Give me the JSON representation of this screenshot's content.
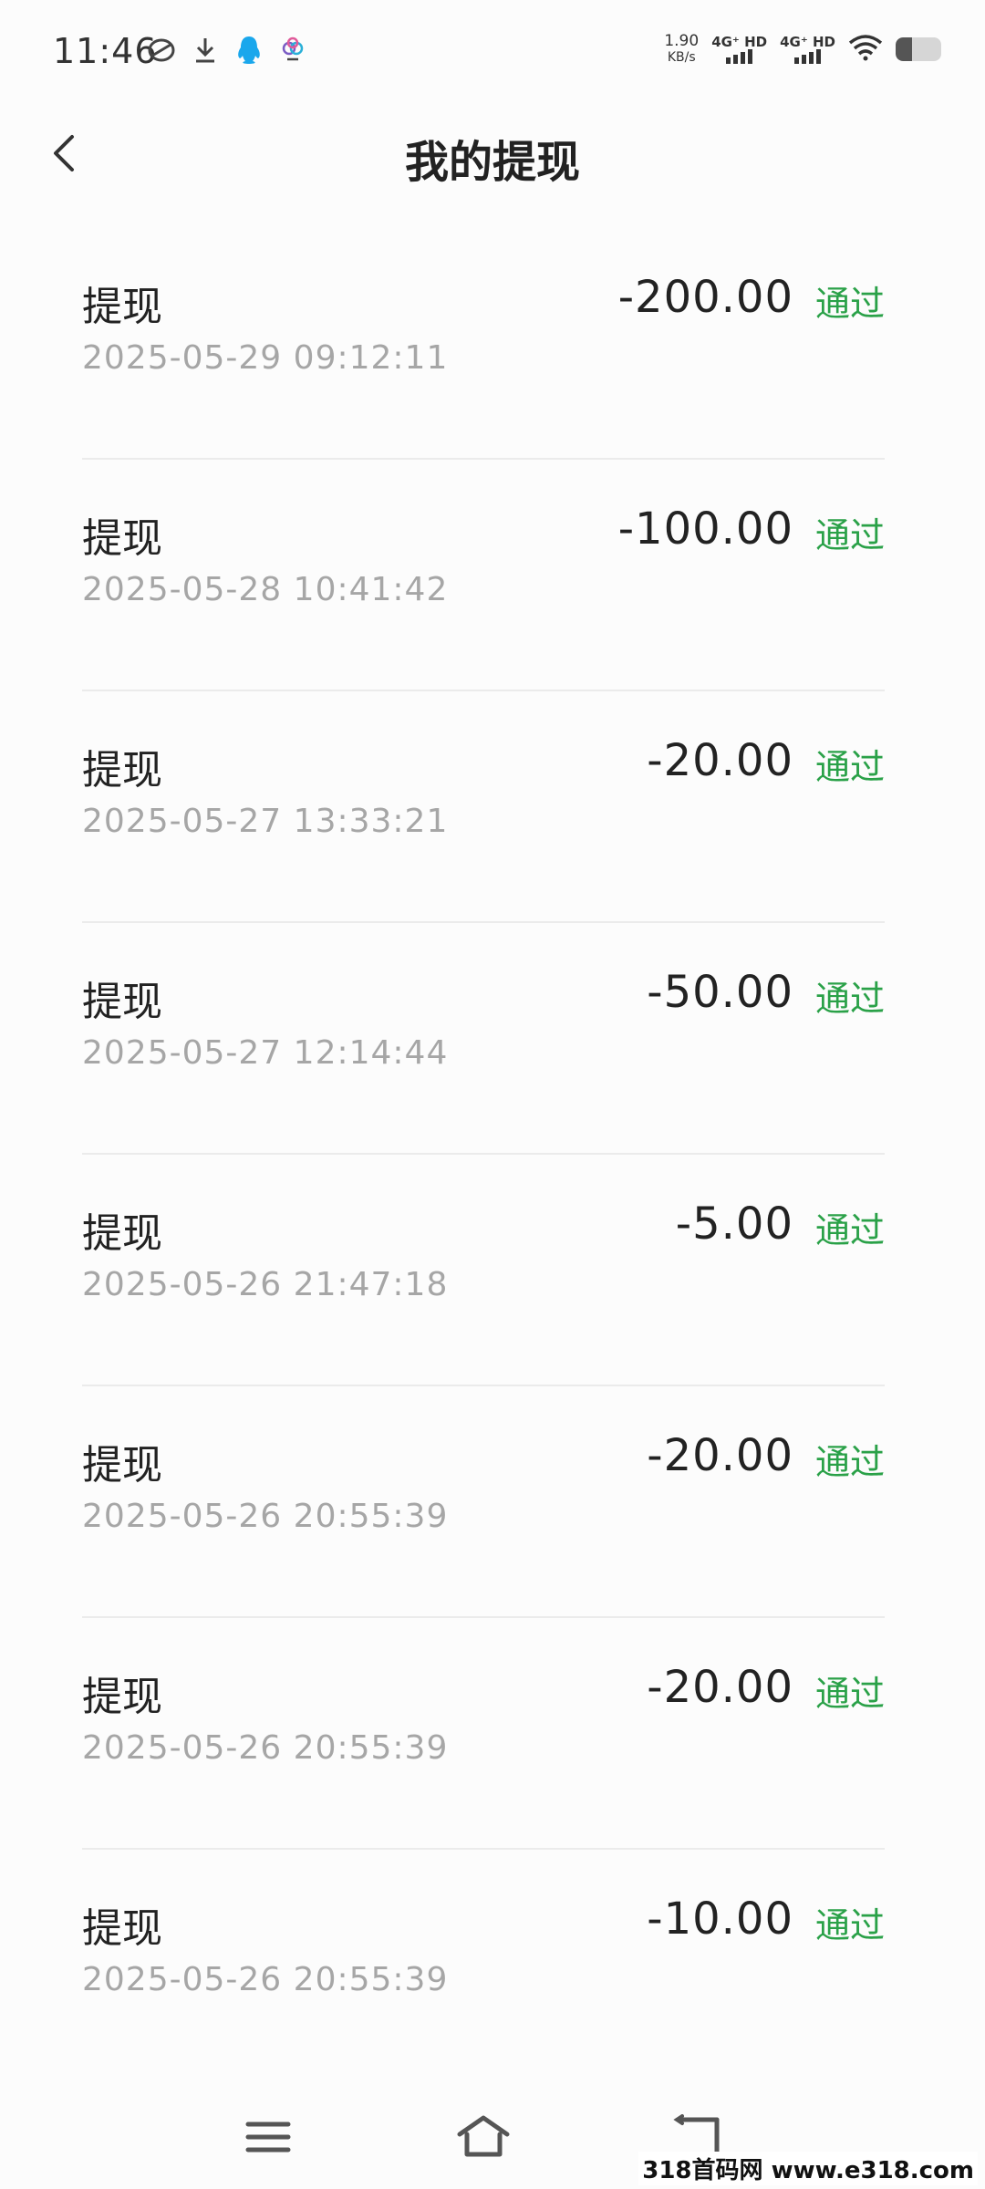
{
  "status_bar": {
    "time": "11:46",
    "speed_value": "1.90",
    "speed_unit": "KB/s",
    "network_1": "4G⁺ HD",
    "network_2": "4G⁺ HD",
    "battery_level": 0.35,
    "icons": [
      "sync-icon",
      "download-icon",
      "qq-icon",
      "app-icon",
      "wifi-icon",
      "battery-icon"
    ]
  },
  "header": {
    "title": "我的提现",
    "back_icon": "chevron-left-icon"
  },
  "withdrawals": [
    {
      "label": "提现",
      "date": "2025-05-29 09:12:11",
      "amount": "-200.00",
      "status": "通过"
    },
    {
      "label": "提现",
      "date": "2025-05-28 10:41:42",
      "amount": "-100.00",
      "status": "通过"
    },
    {
      "label": "提现",
      "date": "2025-05-27 13:33:21",
      "amount": "-20.00",
      "status": "通过"
    },
    {
      "label": "提现",
      "date": "2025-05-27 12:14:44",
      "amount": "-50.00",
      "status": "通过"
    },
    {
      "label": "提现",
      "date": "2025-05-26 21:47:18",
      "amount": "-5.00",
      "status": "通过"
    },
    {
      "label": "提现",
      "date": "2025-05-26 20:55:39",
      "amount": "-20.00",
      "status": "通过"
    },
    {
      "label": "提现",
      "date": "2025-05-26 20:55:39",
      "amount": "-20.00",
      "status": "通过"
    },
    {
      "label": "提现",
      "date": "2025-05-26 20:55:39",
      "amount": "-10.00",
      "status": "通过"
    }
  ],
  "colors": {
    "status_green": "#2aa148",
    "date_gray": "#a6a6a6",
    "text_dark": "#222222"
  },
  "nav": {
    "icons": [
      "menu-icon",
      "home-icon",
      "back-icon"
    ]
  },
  "watermark": "318首码网 www.e318.com"
}
